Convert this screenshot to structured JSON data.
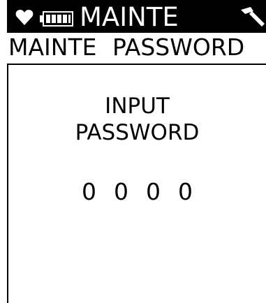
{
  "status_bar": {
    "mode_title": "MAINTE",
    "heart_icon": "heart-icon",
    "battery_icon": "battery-icon",
    "signal_icon": "signal-icon"
  },
  "subtitle": {
    "text": "MAINTE  PASSWORD"
  },
  "prompt": {
    "line1": "INPUT",
    "line2": "PASSWORD"
  },
  "password": {
    "digits": [
      "0",
      "0",
      "0",
      "0"
    ]
  },
  "colors": {
    "background": "#ffffff",
    "foreground": "#000000",
    "status_bar_text": "#ffffff"
  }
}
